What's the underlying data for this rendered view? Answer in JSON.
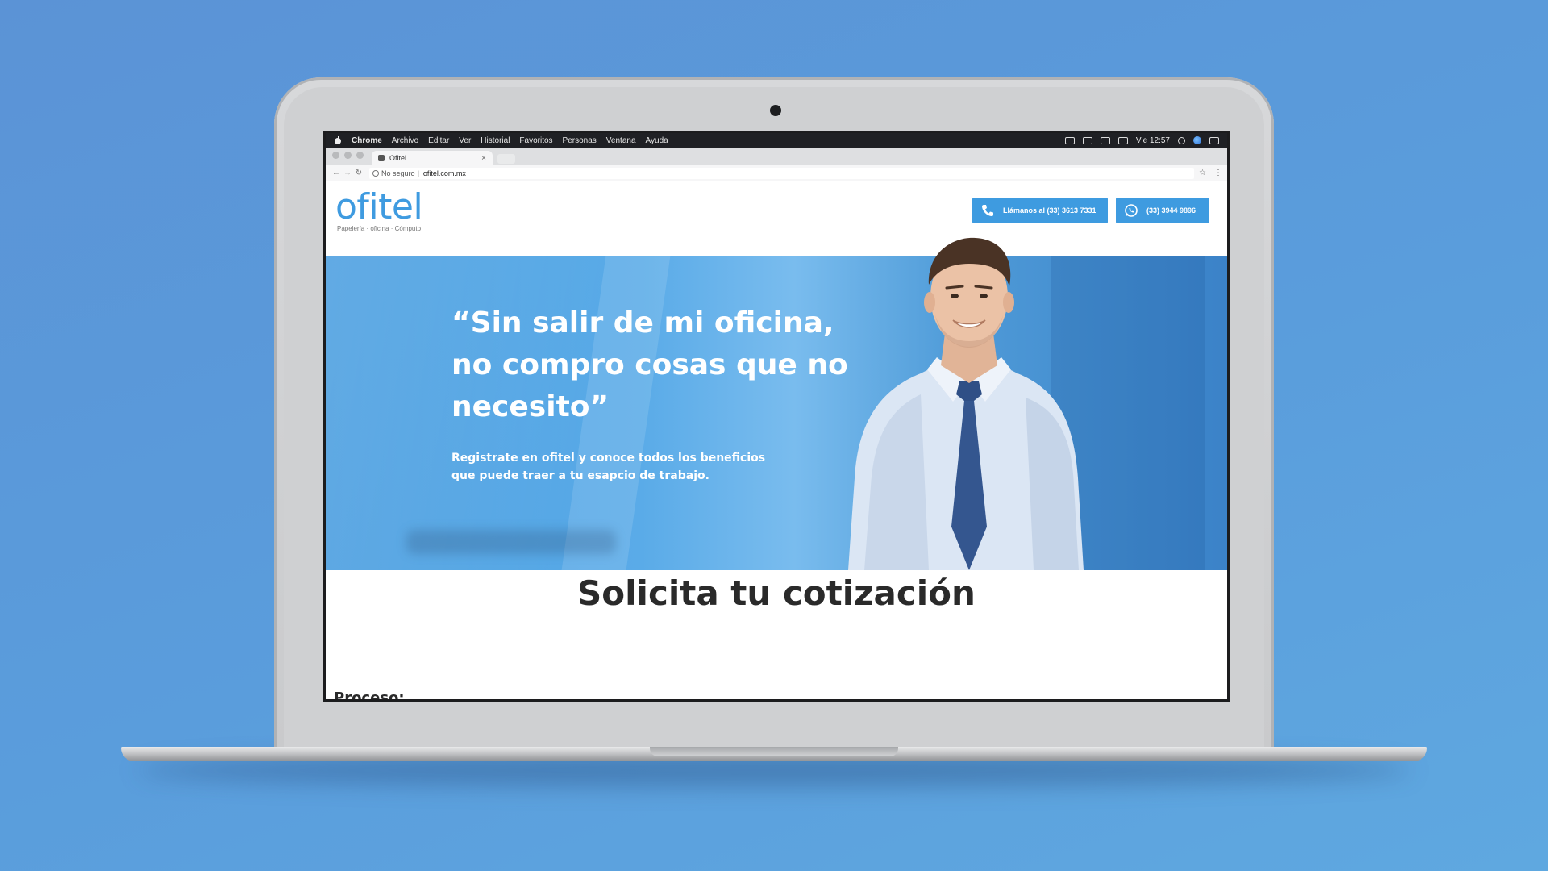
{
  "menubar": {
    "app": "Chrome",
    "items": [
      "Archivo",
      "Editar",
      "Ver",
      "Historial",
      "Favoritos",
      "Personas",
      "Ventana",
      "Ayuda"
    ],
    "clock": "Vie 12:57"
  },
  "browser": {
    "tab_title": "Ofitel",
    "security": "No seguro",
    "url": "ofitel.com.mx"
  },
  "site": {
    "logo": "ofitel",
    "tagline": "Papelería · oficina · Cómputo",
    "call_button": "Llámanos al (33) 3613 7331",
    "whatsapp_button": "(33) 3944 9896",
    "hero_quote": "“Sin salir de mi oficina, no compro cosas que no necesito”",
    "hero_sub": "Registrate en ofitel y conoce todos los beneficios que puede traer a tu esapcio de trabajo.",
    "section_title": "Solicita tu cotización",
    "process_label": "Proceso:"
  },
  "colors": {
    "background": "#5a9ddc",
    "brand": "#3f9be0",
    "button": "#3e9be0",
    "hero": "#5aabe8"
  }
}
